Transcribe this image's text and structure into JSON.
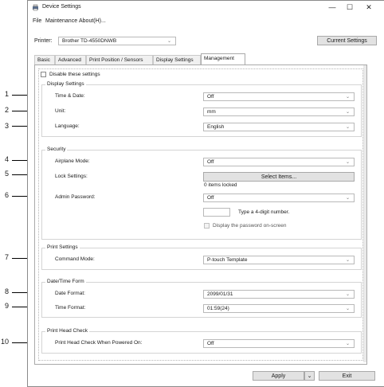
{
  "window": {
    "title": "Device Settings",
    "minimize": "—",
    "maximize": "☐",
    "close": "✕"
  },
  "menu": [
    "File",
    "Maintenance",
    "About(H)..."
  ],
  "printer": {
    "label": "Printer:",
    "value": "Brother TD-4550DNWB"
  },
  "current_settings_button": "Current Settings",
  "tabs": [
    "Basic",
    "Advanced",
    "Print Position / Sensors",
    "Display Settings",
    "Management"
  ],
  "active_tab": "Management",
  "disable_settings": "Disable these settings",
  "display_settings": {
    "title": "Display Settings",
    "time_date": {
      "label": "Time & Date:",
      "value": "Off"
    },
    "unit": {
      "label": "Unit:",
      "value": "mm"
    },
    "language": {
      "label": "Language:",
      "value": "English"
    }
  },
  "security": {
    "title": "Security",
    "airplane_mode": {
      "label": "Airplane Mode:",
      "value": "Off"
    },
    "lock_settings": {
      "label": "Lock Settings:",
      "button": "Select Items...",
      "status": "0 items locked"
    },
    "admin_password": {
      "label": "Admin Password:",
      "value": "Off",
      "hint": "Type a 4-digit number.",
      "display_pw": "Display the password on-screen"
    }
  },
  "print_settings": {
    "title": "Print Settings",
    "command_mode": {
      "label": "Command Mode:",
      "value": "P-touch Template"
    }
  },
  "date_time_form": {
    "title": "Date/Time Form",
    "date_format": {
      "label": "Date Format:",
      "value": "2099/01/31"
    },
    "time_format": {
      "label": "Time Format:",
      "value": "01:59(24)"
    }
  },
  "print_head_check": {
    "title": "Print Head Check",
    "when_powered_on": {
      "label": "Print Head Check When Powered On:",
      "value": "Off"
    }
  },
  "footer": {
    "apply": "Apply",
    "apply_arrow": "⌄",
    "exit": "Exit"
  },
  "callouts": [
    "1",
    "2",
    "3",
    "4",
    "5",
    "6",
    "7",
    "8",
    "9",
    "10"
  ],
  "chevron": "⌄"
}
